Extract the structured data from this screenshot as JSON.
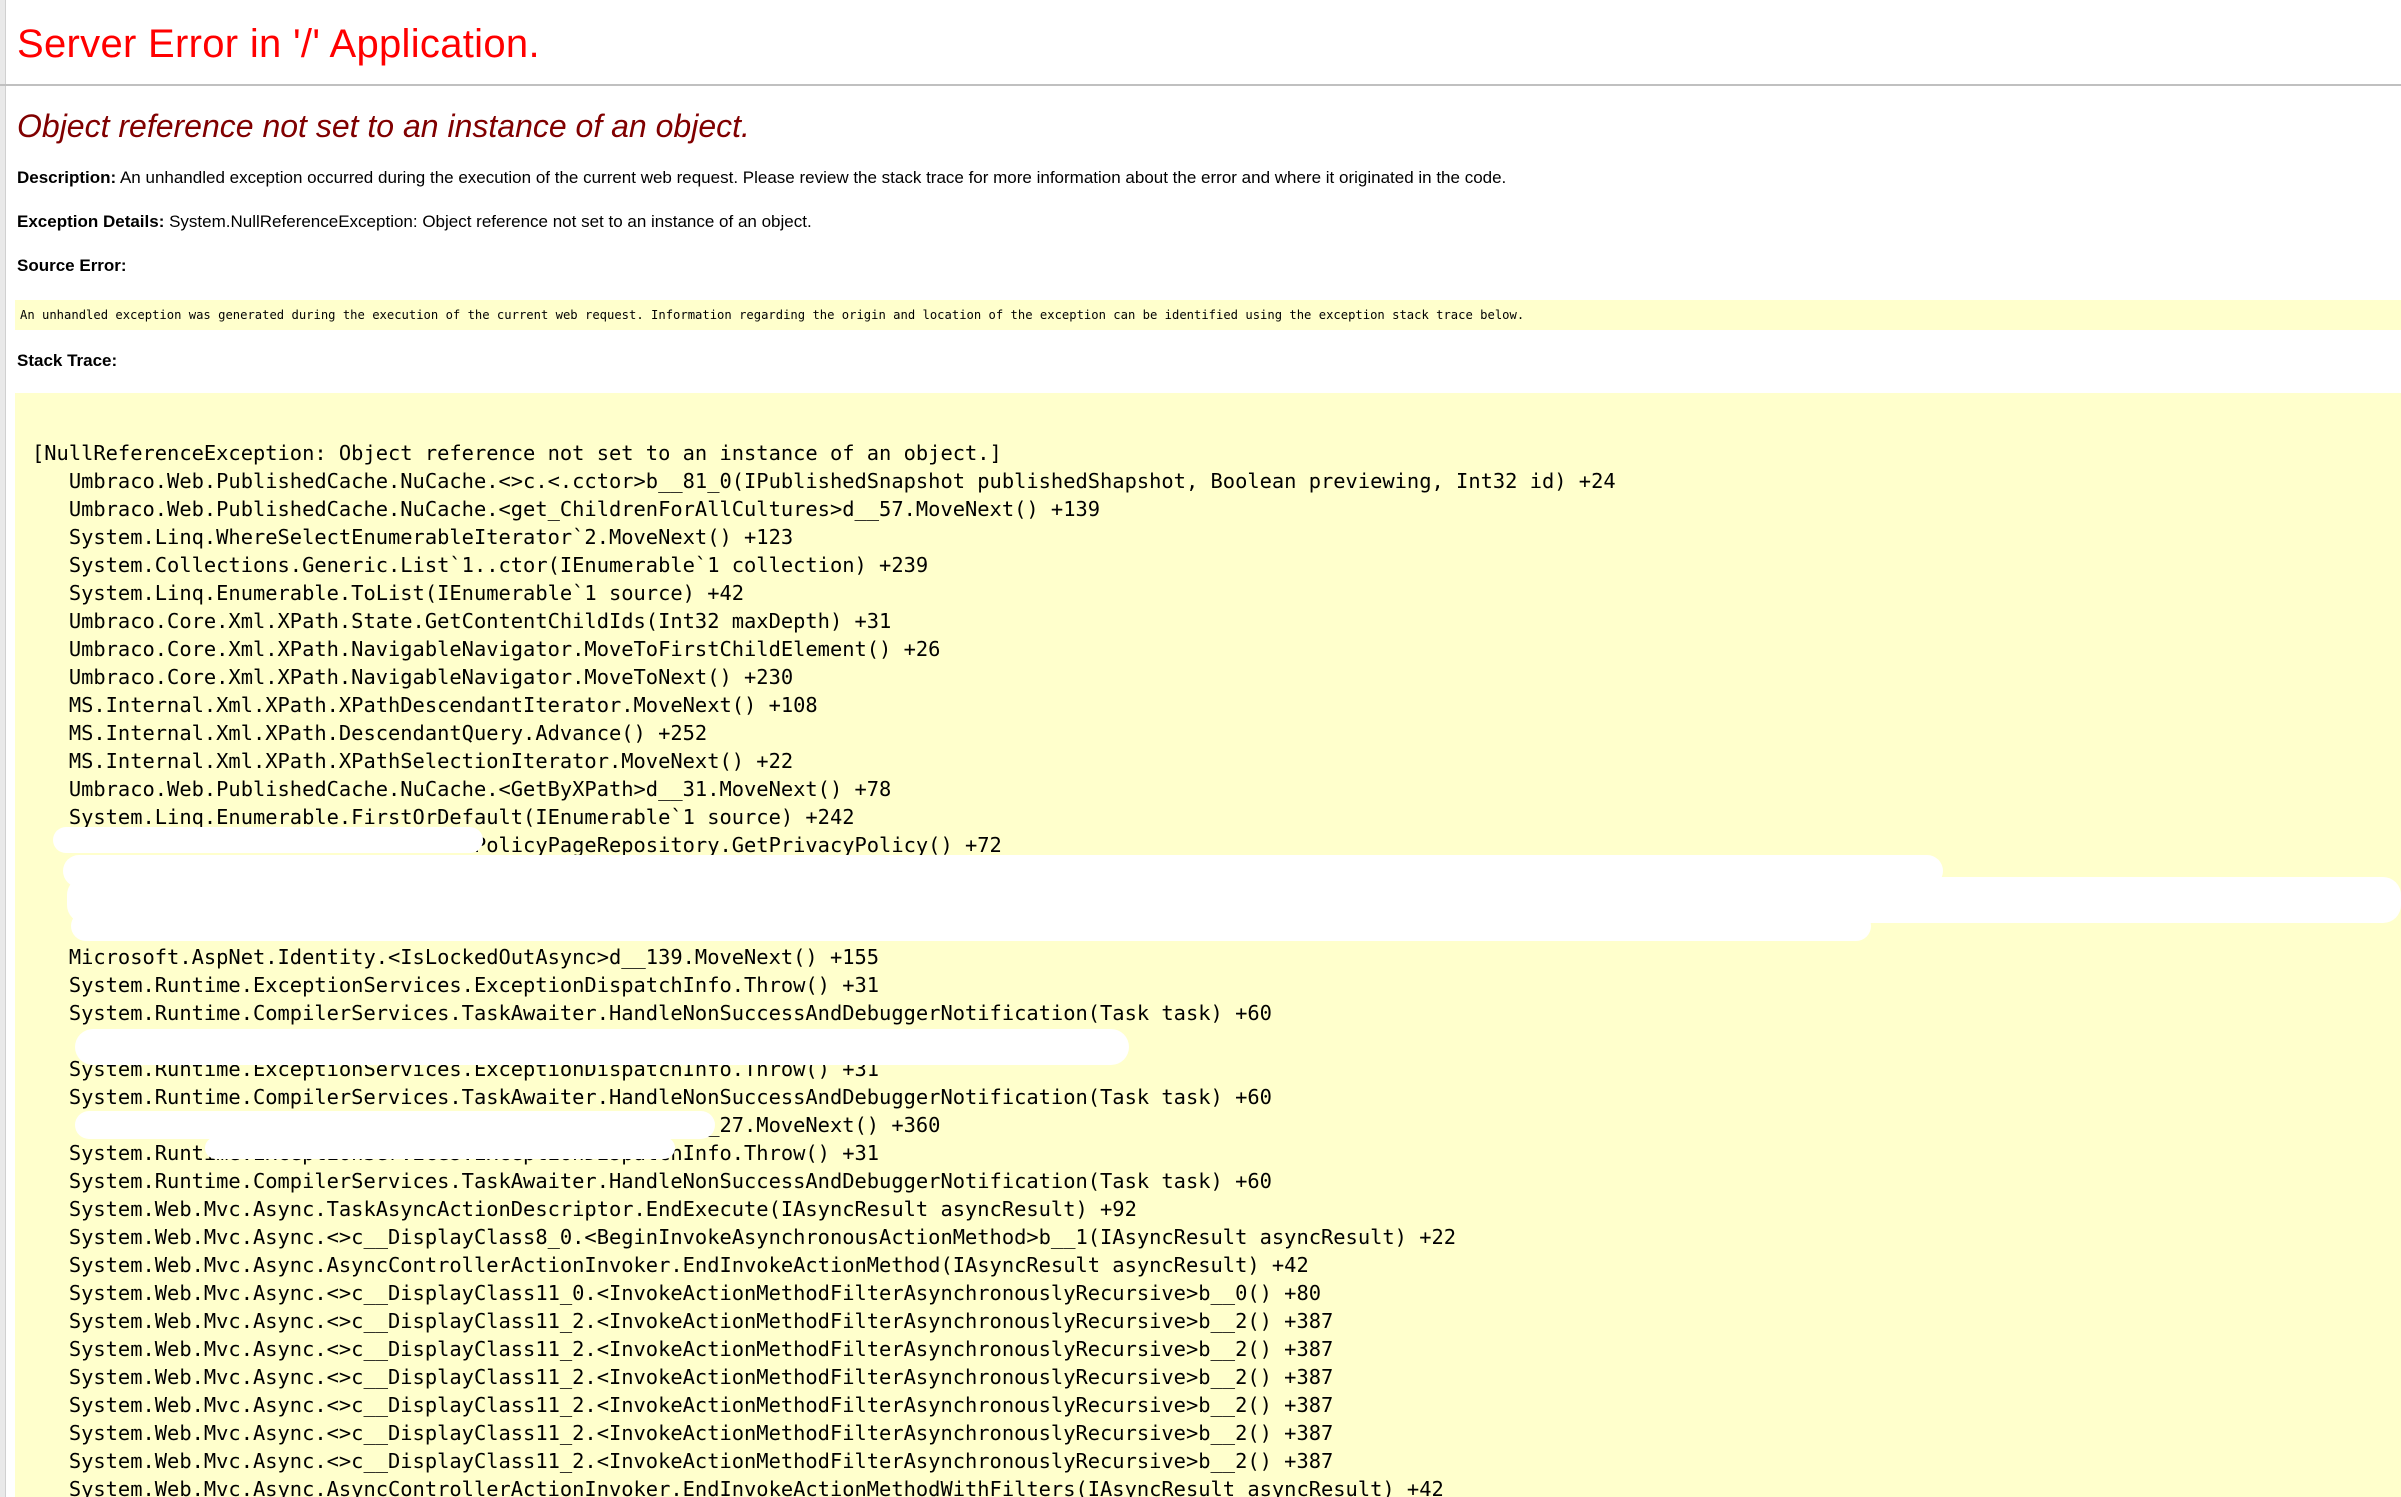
{
  "page": {
    "title": "Server Error in '/' Application.",
    "subtitle": "Object reference not set to an instance of an object."
  },
  "description": {
    "label": "Description:",
    "text": " An unhandled exception occurred during the execution of the current web request. Please review the stack trace for more information about the error and where it originated in the code."
  },
  "exception_details": {
    "label": "Exception Details:",
    "text": " System.NullReferenceException: Object reference not set to an instance of an object."
  },
  "source_error": {
    "label": "Source Error:",
    "text": "An unhandled exception was generated during the execution of the current web request. Information regarding the origin and location of the exception can be identified using the exception stack trace below."
  },
  "stack_trace": {
    "label": "Stack Trace:",
    "lines": [
      "[NullReferenceException: Object reference not set to an instance of an object.]",
      "   Umbraco.Web.PublishedCache.NuCache.<>c.<.cctor>b__81_0(IPublishedSnapshot publishedShapshot, Boolean previewing, Int32 id) +24",
      "   Umbraco.Web.PublishedCache.NuCache.<get_ChildrenForAllCultures>d__57.MoveNext() +139",
      "   System.Linq.WhereSelectEnumerableIterator`2.MoveNext() +123",
      "   System.Collections.Generic.List`1..ctor(IEnumerable`1 collection) +239",
      "   System.Linq.Enumerable.ToList(IEnumerable`1 source) +42",
      "   Umbraco.Core.Xml.XPath.State.GetContentChildIds(Int32 maxDepth) +31",
      "   Umbraco.Core.Xml.XPath.NavigableNavigator.MoveToFirstChildElement() +26",
      "   Umbraco.Core.Xml.XPath.NavigableNavigator.MoveToNext() +230",
      "   MS.Internal.Xml.XPath.XPathDescendantIterator.MoveNext() +108",
      "   MS.Internal.Xml.XPath.DescendantQuery.Advance() +252",
      "   MS.Internal.Xml.XPath.XPathSelectionIterator.MoveNext() +22",
      "   Umbraco.Web.PublishedCache.NuCache.<GetByXPath>d__31.MoveNext() +78",
      "   System.Linq.Enumerable.FirstOrDefault(IEnumerable`1 source) +242",
      "                                    PolicyPageRepository.GetPrivacyPolicy() +72",
      "",
      "",
      "",
      "   Microsoft.AspNet.Identity.<IsLockedOutAsync>d__139.MoveNext() +155",
      "   System.Runtime.ExceptionServices.ExceptionDispatchInfo.Throw() +31",
      "   System.Runtime.CompilerServices.TaskAwaiter.HandleNonSuccessAndDebuggerNotification(Task task) +60",
      "",
      "   System.Runtime.ExceptionServices.ExceptionDispatchInfo.Throw() +31",
      "   System.Runtime.CompilerServices.TaskAwaiter.HandleNonSuccessAndDebuggerNotification(Task task) +60",
      "                                                       _27.MoveNext() +360",
      "   System.Runtime.ExceptionServices.ExceptionDispatchInfo.Throw() +31",
      "   System.Runtime.CompilerServices.TaskAwaiter.HandleNonSuccessAndDebuggerNotification(Task task) +60",
      "   System.Web.Mvc.Async.TaskAsyncActionDescriptor.EndExecute(IAsyncResult asyncResult) +92",
      "   System.Web.Mvc.Async.<>c__DisplayClass8_0.<BeginInvokeAsynchronousActionMethod>b__1(IAsyncResult asyncResult) +22",
      "   System.Web.Mvc.Async.AsyncControllerActionInvoker.EndInvokeActionMethod(IAsyncResult asyncResult) +42",
      "   System.Web.Mvc.Async.<>c__DisplayClass11_0.<InvokeActionMethodFilterAsynchronouslyRecursive>b__0() +80",
      "   System.Web.Mvc.Async.<>c__DisplayClass11_2.<InvokeActionMethodFilterAsynchronouslyRecursive>b__2() +387",
      "   System.Web.Mvc.Async.<>c__DisplayClass11_2.<InvokeActionMethodFilterAsynchronouslyRecursive>b__2() +387",
      "   System.Web.Mvc.Async.<>c__DisplayClass11_2.<InvokeActionMethodFilterAsynchronouslyRecursive>b__2() +387",
      "   System.Web.Mvc.Async.<>c__DisplayClass11_2.<InvokeActionMethodFilterAsynchronouslyRecursive>b__2() +387",
      "   System.Web.Mvc.Async.<>c__DisplayClass11_2.<InvokeActionMethodFilterAsynchronouslyRecursive>b__2() +387",
      "   System.Web.Mvc.Async.<>c__DisplayClass11_2.<InvokeActionMethodFilterAsynchronouslyRecursive>b__2() +387",
      "   System.Web.Mvc.Async.AsyncControllerActionInvoker.EndInvokeActionMethodWithFilters(IAsyncResult asyncResult) +42"
    ]
  },
  "colors": {
    "title": "#ff0000",
    "subtitle": "#800000",
    "code_background": "#ffffcc"
  }
}
